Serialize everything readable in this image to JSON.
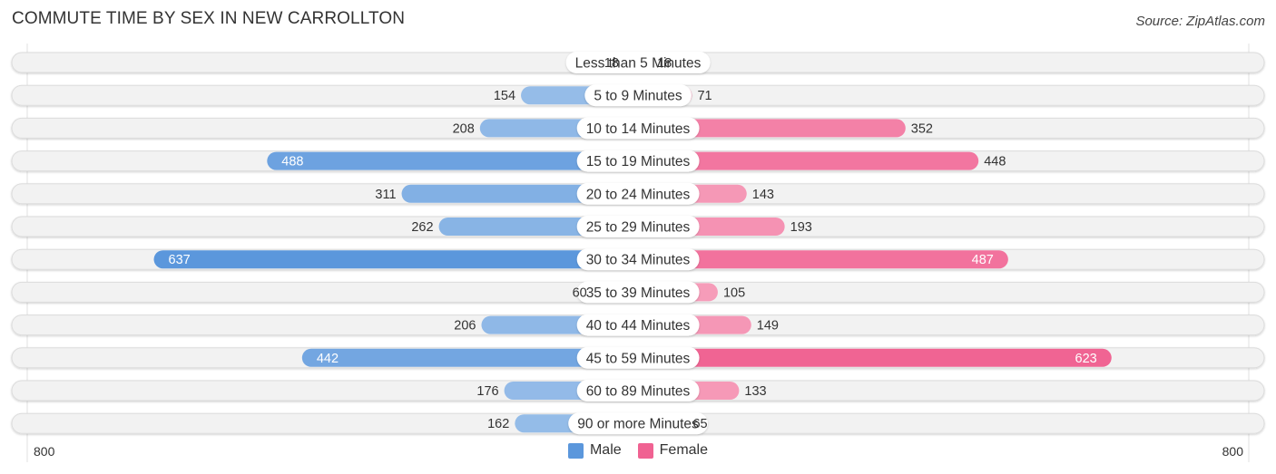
{
  "title": "COMMUTE TIME BY SEX IN NEW CARROLLTON",
  "source": "Source: ZipAtlas.com",
  "colors": {
    "male_light": "#a8c8ec",
    "male_dark": "#5b97dc",
    "female_light": "#f7a7c1",
    "female_dark": "#f06292",
    "row_bg": "#f2f2f2",
    "row_border": "#dcdcdc",
    "text": "#333333"
  },
  "legend": {
    "male": "Male",
    "female": "Female"
  },
  "axis": {
    "left_label": "800",
    "right_label": "800"
  },
  "chart_data": {
    "type": "bar",
    "orientation": "horizontal-diverging",
    "title": "COMMUTE TIME BY SEX IN NEW CARROLLTON",
    "categories": [
      "Less than 5 Minutes",
      "5 to 9 Minutes",
      "10 to 14 Minutes",
      "15 to 19 Minutes",
      "20 to 24 Minutes",
      "25 to 29 Minutes",
      "30 to 34 Minutes",
      "35 to 39 Minutes",
      "40 to 44 Minutes",
      "45 to 59 Minutes",
      "60 to 89 Minutes",
      "90 or more Minutes"
    ],
    "series": [
      {
        "name": "Male",
        "values": [
          18,
          154,
          208,
          488,
          311,
          262,
          637,
          60,
          206,
          442,
          176,
          162
        ]
      },
      {
        "name": "Female",
        "values": [
          18,
          71,
          352,
          448,
          143,
          193,
          487,
          105,
          149,
          623,
          133,
          65
        ]
      }
    ],
    "xlim": [
      -800,
      800
    ],
    "tick_labels": [
      "800",
      "800"
    ],
    "legend_position": "bottom-center",
    "grid": false
  }
}
